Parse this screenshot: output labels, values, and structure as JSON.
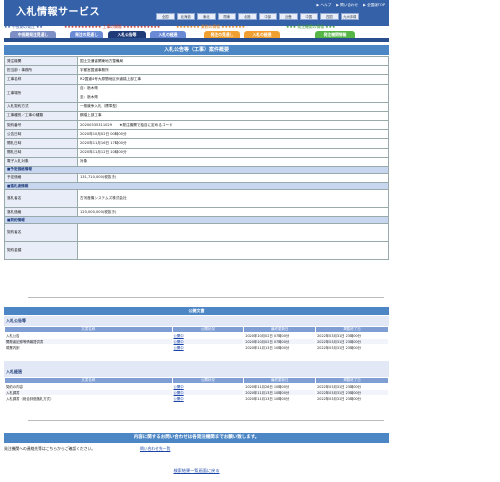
{
  "header": {
    "brand": "入札情報サービス",
    "links": [
      "▶ ヘルプ",
      "▶ 問い合わせ",
      "▶ 全国版TOP"
    ],
    "regions": [
      "全国",
      "北海道",
      "東北",
      "関東",
      "北陸",
      "中部",
      "近畿",
      "中国",
      "四国",
      "九州沖縄"
    ]
  },
  "nav": {
    "group1": "★★ 中長期の発注 ★★",
    "group2": "★★★★★★★★★★★ 工事の情報 ★★★★★★★★★★★",
    "group3": "★★★★★★★ 業務の情報 ★★★★★★★",
    "group4": "★★★ 発注機関の情報 ★★★"
  },
  "tabs": [
    "中長期発注見通し",
    "発注の見通し",
    "入札公告等",
    "入札の経過",
    "発注の見通し",
    "入札の経過",
    "発注機関情報"
  ],
  "title": "入札公告等（工事）案件概要",
  "info": [
    {
      "k": "発注機関",
      "v": "国土交通省関東地方整備局"
    },
    {
      "k": "担当部・事務所",
      "v": "宇都宮国道事務所"
    },
    {
      "k": "工事名称",
      "v": "R2国道4号大原間地区歩道橋上部工事"
    },
    {
      "k": "工事場所",
      "v": "自：栃木県",
      "v2": "至：栃木県"
    },
    {
      "k": "入札契約方式",
      "v": "一般競争入札（標準型）"
    },
    {
      "k": "工事種別／工事の種類",
      "v": "鋼橋上部工事"
    },
    {
      "k": "契約番号",
      "v": "20200335311029　　★発注機関で独自に定めるコード"
    },
    {
      "k": "公告日時",
      "v": "2020年10月02日 00時00分"
    },
    {
      "k": "開札日時",
      "v": "2020年11月16日 17時00分"
    },
    {
      "k": "開札日時",
      "v": "2020年11月12日 10時00分"
    },
    {
      "k": "電子入札対象",
      "v": "対象"
    }
  ],
  "sections": {
    "estimate": "■予定価格情報",
    "award": "■落札者情報",
    "contract": "■契約情報"
  },
  "estimate": [
    {
      "k": "予定価格",
      "v": "131,710,000(税抜き)"
    }
  ],
  "award": [
    {
      "k": "落札者名",
      "v": "古河産機システムズ株式会社"
    },
    {
      "k": "落札価格",
      "v": "120,000,000(税抜き)"
    }
  ],
  "contract": [
    {
      "k": "契約者名",
      "v": ""
    },
    {
      "k": "契約金額",
      "v": ""
    }
  ],
  "docs": {
    "bar": "公開文書",
    "headers": [
      "文書名称",
      "公開状況",
      "最終更新日",
      "掲載終了日"
    ],
    "group1": {
      "title": "入札公告等",
      "rows": [
        [
          "入札公告",
          "公開中",
          "2020年10月02日 07時00分",
          "2022年03月31日 23時00分"
        ],
        [
          "開発者記録等情報提供書",
          "公開中",
          "2020年10月02日 07時00分",
          "2022年03月31日 23時00分"
        ],
        [
          "現業内訳",
          "公開中",
          "2020年11月13日 10時00分",
          "2022年03月31日 23時00分"
        ]
      ]
    },
    "group2": {
      "title": "入札経過",
      "rows": [
        [
          "契約の内容",
          "公開中",
          "2020年11月26日 10時00分",
          "2022年03月31日 23時00分"
        ],
        [
          "入札調書",
          "公開中",
          "2020年11月13日 10時00分",
          "2022年03月31日 23時00分"
        ],
        [
          "入札調書（総合評価落札方式）",
          "公開中",
          "2020年11月13日 10時00分",
          "2022年03月31日 23時00分"
        ]
      ]
    }
  },
  "contact": {
    "bar": "内容に関するお問い合わせは各発注機関までお願い致します。",
    "left": "発注機関への連絡先等はこちらからご確認ください。",
    "link": "問い合わせ先一覧"
  },
  "back": "検索結果一覧画面に戻る"
}
